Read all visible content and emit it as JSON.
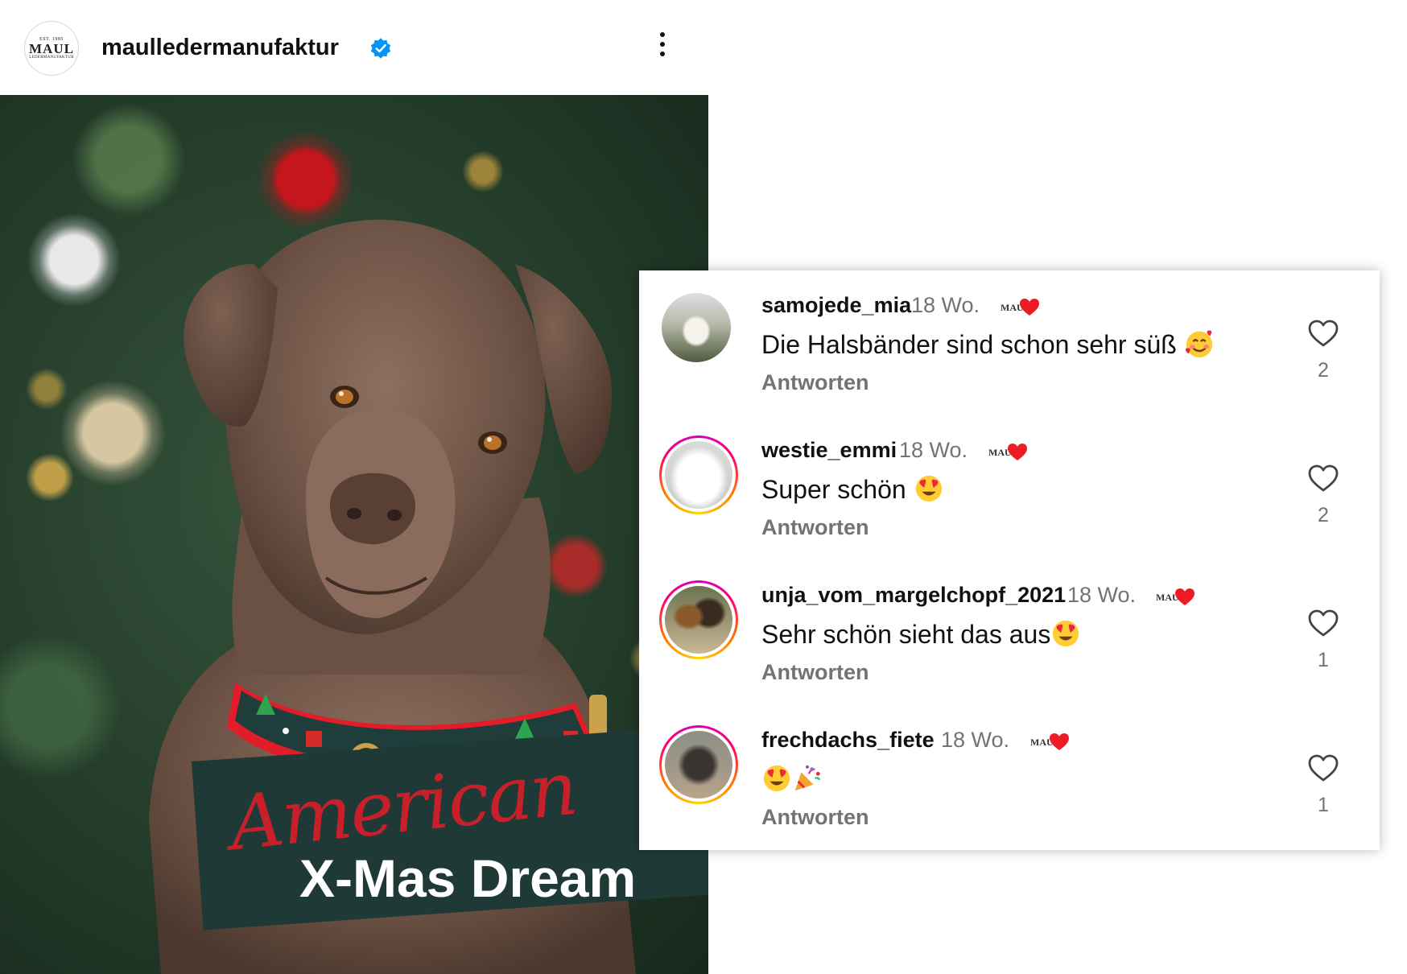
{
  "post": {
    "account_name": "maulledermanufaktur",
    "avatar_logo": {
      "top": "EST. 1985",
      "word": "MAUL",
      "sub": "LEDERMANUFAKTUR"
    },
    "verified": true,
    "more_icon": "more-vertical-icon"
  },
  "image": {
    "title_script": "American",
    "title_main": "X-Mas Dream"
  },
  "comments": [
    {
      "user": "samojede_mia",
      "time": "18 Wo.",
      "text": "Die Halsbänder sind schon sehr süß",
      "emoji": [
        "smiling-face-with-hearts"
      ],
      "reply": "Antworten",
      "likes": "2",
      "avatar_ring": false
    },
    {
      "user": "westie_emmi",
      "time": "18 Wo.",
      "text": "Super schön",
      "emoji": [
        "heart-eyes"
      ],
      "reply": "Antworten",
      "likes": "2",
      "avatar_ring": true
    },
    {
      "user": "unja_vom_margelchopf_2021",
      "time": "18 Wo.",
      "text": "Sehr schön sieht das aus",
      "emoji": [
        "heart-eyes"
      ],
      "reply": "Antworten",
      "likes": "1",
      "avatar_ring": true
    },
    {
      "user": "frechdachs_fiete",
      "time": "18 Wo.",
      "text": "",
      "emoji": [
        "heart-eyes",
        "party-popper"
      ],
      "reply": "Antworten",
      "likes": "1",
      "avatar_ring": true
    }
  ],
  "colors": {
    "verified": "#0095f6",
    "liked_heart": "#ed1c24",
    "plate": "#1f3a36",
    "script": "#c8202a"
  }
}
